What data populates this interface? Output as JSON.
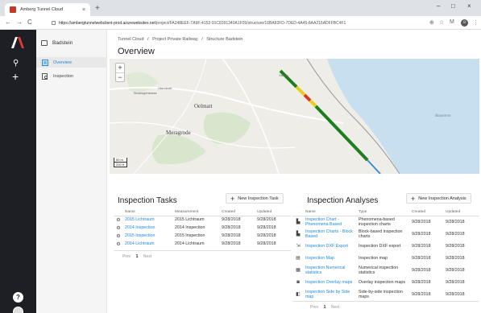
{
  "browser": {
    "tab_title": "Amberg Tunnel Cloud",
    "tab_close": "×",
    "new_tab": "+",
    "url_host": "https://ambergtunnelwebclient-prod.azurewebsites.net",
    "url_path": "/project/FA248EEF-7A9F-4152-91C8391340A1F09/structure/16BA82FD-7DED-4A45-8AA216ADFFBC4F1",
    "nav_back": "←",
    "nav_forward": "→",
    "nav_reload": "C",
    "zoom_icon": "⊕",
    "star_icon": "☆",
    "menu_m": "M",
    "profile": "⊙",
    "kebab": "⋮",
    "min": "–",
    "max": "□",
    "close": "×"
  },
  "rail": {
    "search": "⚲",
    "add": "+",
    "help": "?"
  },
  "sidebar": {
    "header": "Badstein",
    "items": [
      {
        "label": "Overview",
        "active": true
      },
      {
        "label": "Inspection",
        "active": false
      }
    ]
  },
  "breadcrumb": [
    "Tunnel Cloud",
    "/",
    "Project Private Railway",
    "/",
    "Structure Badstein"
  ],
  "page_title": "Overview",
  "map": {
    "zoom_in": "+",
    "zoom_out": "−",
    "scale_top": "50 m",
    "scale_bottom": "200 ft",
    "labels": [
      "Oelmatt",
      "Meragrode",
      "Oberolmatt",
      "Gisikon",
      "Stradbagerstrasse",
      "Baumtren"
    ]
  },
  "tasks": {
    "title": "Inspection Tasks",
    "new_button": "New Inspection Task",
    "columns": [
      "Name",
      "Measurement",
      "Created",
      "Updated"
    ],
    "rows": [
      {
        "name": "2015 Lichtraum",
        "measurement": "2015 Lichtraum",
        "created": "9/28/2018",
        "updated": "9/28/2018"
      },
      {
        "name": "2014 Inspection",
        "measurement": "2014 Inspection",
        "created": "9/28/2018",
        "updated": "9/28/2018"
      },
      {
        "name": "2015 Inspection",
        "measurement": "2015 Inspection",
        "created": "9/28/2018",
        "updated": "9/28/2018"
      },
      {
        "name": "2014 Lichtraum",
        "measurement": "2014 Lichtraum",
        "created": "9/28/2018",
        "updated": "9/28/2018"
      }
    ],
    "pager": {
      "prev": "Prev",
      "page": "1",
      "next": "Next"
    }
  },
  "analyses": {
    "title": "Inspection Analyses",
    "new_button": "New Inspection Analysis",
    "columns": [
      "Name",
      "Type",
      "Created",
      "Updated"
    ],
    "rows": [
      {
        "name": "Inspection Chart - Phenomena Based",
        "type": "Phenomena-based inspection charts",
        "created": "9/28/2018",
        "updated": "9/28/2018"
      },
      {
        "name": "Inspection Charts - Block Based",
        "type": "Block-based inspection charts",
        "created": "9/28/2018",
        "updated": "9/28/2018"
      },
      {
        "name": "Inspection DXF Export",
        "type": "Inspection DXF export",
        "created": "9/28/2018",
        "updated": "9/28/2018"
      },
      {
        "name": "Inspection Map",
        "type": "Inspection map",
        "created": "9/28/2018",
        "updated": "9/28/2018"
      },
      {
        "name": "Inspection Numerical statistics",
        "type": "Numerical inspection statistics",
        "created": "9/28/2018",
        "updated": "9/28/2018"
      },
      {
        "name": "Inspection Overlay maps",
        "type": "Overlay inspection maps",
        "created": "9/28/2018",
        "updated": "9/28/2018"
      },
      {
        "name": "Inspection Side by Side map",
        "type": "Side-by-side inspection maps",
        "created": "9/28/2018",
        "updated": "9/28/2018"
      }
    ],
    "pager": {
      "prev": "Prev",
      "page": "1",
      "next": "Next"
    }
  },
  "colors": {
    "accent": "#1e88e5",
    "rail": "#1d1f24",
    "tunnel_green": "#1e7d1e",
    "tunnel_yellow": "#e6d01e",
    "tunnel_red": "#d93a1e",
    "water": "#c8dff0"
  }
}
